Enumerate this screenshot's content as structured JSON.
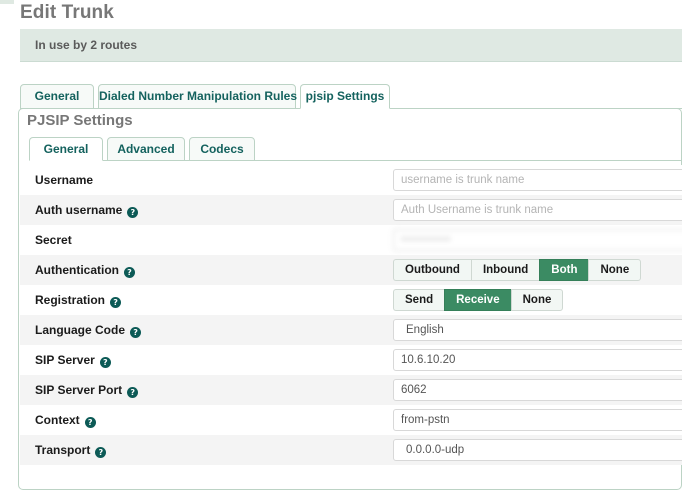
{
  "page": {
    "title": "Edit Trunk",
    "banner_text": "In use by 2 routes"
  },
  "outer_tabs": [
    {
      "label": "General",
      "active": false
    },
    {
      "label": "Dialed Number Manipulation Rules",
      "active": false
    },
    {
      "label": "pjsip Settings",
      "active": true
    }
  ],
  "panel": {
    "title": "PJSIP Settings",
    "inner_tabs": [
      {
        "label": "General",
        "active": true
      },
      {
        "label": "Advanced",
        "active": false
      },
      {
        "label": "Codecs",
        "active": false
      }
    ]
  },
  "form": {
    "rows": [
      {
        "label": "Username",
        "help": false,
        "kind": "input",
        "value": "",
        "placeholder": "username is trunk name"
      },
      {
        "label": "Auth username",
        "help": true,
        "kind": "input",
        "value": "",
        "placeholder": "Auth Username is trunk name"
      },
      {
        "label": "Secret",
        "help": false,
        "kind": "password",
        "value": "•••••••••••",
        "placeholder": ""
      },
      {
        "label": "Authentication",
        "help": true,
        "kind": "buttons",
        "options": [
          "Outbound",
          "Inbound",
          "Both",
          "None"
        ],
        "selected": "Both"
      },
      {
        "label": "Registration",
        "help": true,
        "kind": "buttons",
        "options": [
          "Send",
          "Receive",
          "None"
        ],
        "selected": "Receive"
      },
      {
        "label": "Language Code",
        "help": true,
        "kind": "select",
        "value": "English",
        "placeholder": ""
      },
      {
        "label": "SIP Server",
        "help": true,
        "kind": "input",
        "value": "10.6.10.20",
        "placeholder": ""
      },
      {
        "label": "SIP Server Port",
        "help": true,
        "kind": "input",
        "value": "6062",
        "placeholder": ""
      },
      {
        "label": "Context",
        "help": true,
        "kind": "input",
        "value": "from-pstn",
        "placeholder": ""
      },
      {
        "label": "Transport",
        "help": true,
        "kind": "select",
        "value": "0.0.0.0-udp",
        "placeholder": ""
      }
    ]
  },
  "icons": {
    "help": "?"
  },
  "colors": {
    "accent_green": "#3b8b63",
    "tab_text": "#14625e",
    "banner_bg": "#dfe9e3",
    "border_green": "#bcd3c5",
    "row_alt": "#f4f4f4"
  }
}
